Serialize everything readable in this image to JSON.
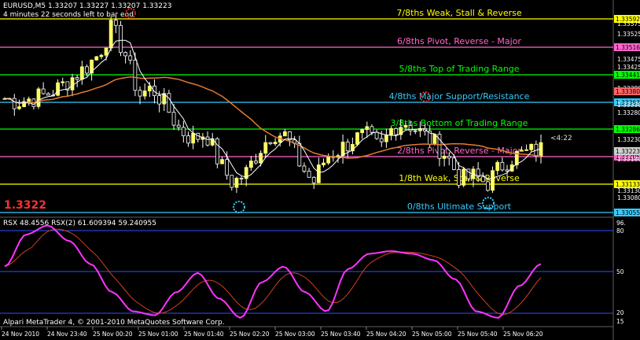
{
  "window": {
    "symbol_title": "EURUSD,M5  1.33207 1.33227 1.33207 1.33223",
    "countdown": "4 minutes 22 seconds left to bar end",
    "big_price": "1.3322",
    "timer_label": "<4:22",
    "footer": "Alpari MetaTrader 4, © 2001-2010 MetaQuotes Software Corp."
  },
  "colors": {
    "background": "#000000",
    "bull_candle": "#ffff66",
    "bear_candle": "#000000",
    "wick": "#ffffff",
    "slow_ma": "#e07b30",
    "fast_ma": "#ffffff",
    "rsx": "#ff33ff",
    "rsx_signal": "#d04020",
    "current_price": "#ff3030"
  },
  "levels": [
    {
      "label": "7/8ths Weak, Stall & Reverse",
      "price": "1.33592",
      "color": "#ffff00"
    },
    {
      "label": "6/8ths Pivot, Reverse - Major",
      "price": "1.33516",
      "color": "#ff66cc"
    },
    {
      "label": "5/8ths Top of Trading Range",
      "price": "1.33441",
      "color": "#00ff00"
    },
    {
      "label": "4/8ths Major Support/Resistance",
      "price": "1.33363",
      "color": "#33ccff"
    },
    {
      "label": "3/8ths Bottom of Trading Range",
      "price": "1.33286",
      "color": "#00ff00"
    },
    {
      "label": "2/8ths Pivot, Reverse - Major",
      "price": "1.33205",
      "color": "#ff66cc"
    },
    {
      "label": "1/8th Weak, Stall & Reverse",
      "price": "1.33133",
      "color": "#ffff00"
    },
    {
      "label": "0/8ths Ultimate Support",
      "price": "1.33055",
      "color": "#33ccff"
    }
  ],
  "price_axis": {
    "ticks": [
      "1.33575",
      "1.33525",
      "1.33475",
      "1.33425",
      "1.33380",
      "1.33330",
      "1.33280",
      "1.33230",
      "1.33180",
      "1.33130",
      "1.33080"
    ],
    "current": "1.33223",
    "current_color": "#d0d0d0",
    "extra_tag": "1.33380",
    "extra_tag_color": "#ff6666"
  },
  "time_axis": [
    "24 Nov 2010",
    "24 Nov 23:40",
    "25 Nov 00:20",
    "25 Nov 01:00",
    "25 Nov 01:40",
    "25 Nov 02:20",
    "25 Nov 03:00",
    "25 Nov 03:40",
    "25 Nov 04:20",
    "25 Nov 05:00",
    "25 Nov 05:40",
    "25 Nov 06:20"
  ],
  "indicator": {
    "title": "RSX 48.4556  RSX(2) 61.609394 59.240955",
    "levels": [
      "80",
      "50",
      "20"
    ],
    "top_label": "96.",
    "bottom_label": "15"
  },
  "chart_data": {
    "type": "candlestick",
    "symbol": "EURUSD",
    "timeframe": "M5",
    "x": [
      "24 Nov 2010",
      "24 Nov 23:40",
      "25 Nov 00:20",
      "25 Nov 01:00",
      "25 Nov 01:40",
      "25 Nov 02:20",
      "25 Nov 03:00",
      "25 Nov 03:40",
      "25 Nov 04:20",
      "25 Nov 05:00",
      "25 Nov 05:40",
      "25 Nov 06:20"
    ],
    "close_path": [
      1.3337,
      1.3336,
      1.3337,
      1.3338,
      1.334,
      1.3343,
      1.3346,
      1.335,
      1.3358,
      1.335,
      1.3338,
      1.334,
      1.3335,
      1.3328,
      1.3325,
      1.3327,
      1.3318,
      1.3312,
      1.3315,
      1.3322,
      1.3327,
      1.3326,
      1.3318,
      1.3312,
      1.332,
      1.3322,
      1.3325,
      1.3326,
      1.3322,
      1.3329,
      1.333,
      1.3327,
      1.3324,
      1.332,
      1.3313,
      1.3314,
      1.3312,
      1.3317,
      1.332,
      1.3321,
      1.3322
    ],
    "ylim": [
      1.3302,
      1.3366
    ],
    "rsx": [
      60,
      85,
      92,
      80,
      62,
      40,
      25,
      22,
      40,
      55,
      35,
      20,
      48,
      60,
      40,
      25,
      58,
      70,
      72,
      70,
      65,
      50,
      25,
      20,
      45,
      62
    ],
    "rsx_ylim": [
      15,
      96
    ]
  }
}
